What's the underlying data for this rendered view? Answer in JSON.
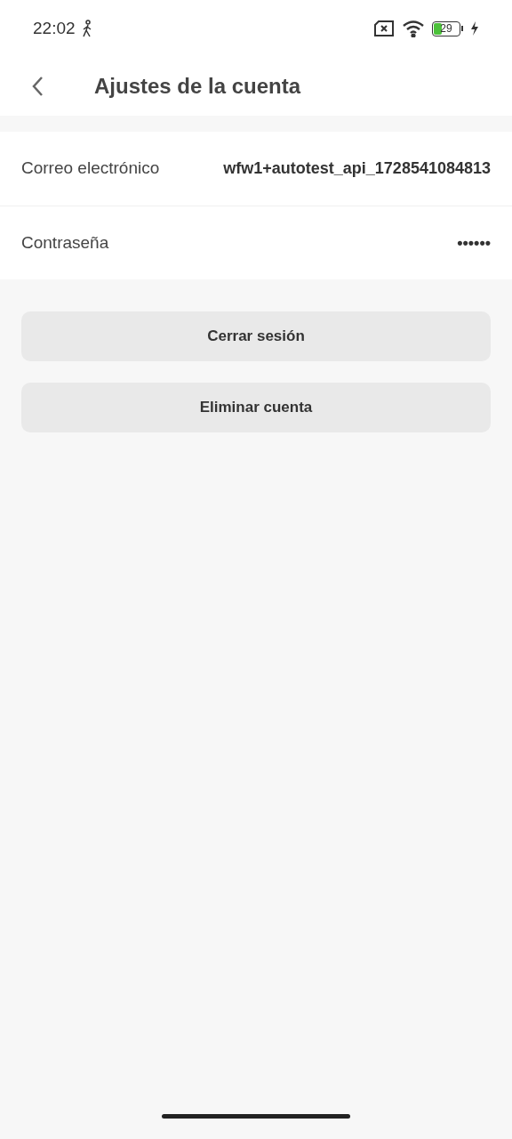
{
  "status_bar": {
    "time": "22:02",
    "battery": "29"
  },
  "header": {
    "title": "Ajustes de la cuenta"
  },
  "fields": [
    {
      "label": "Correo electrónico",
      "value": "wfw1+autotest_api_1728541084813"
    },
    {
      "label": "Contraseña",
      "value": "••••••"
    }
  ],
  "buttons": [
    "Cerrar sesión",
    "Eliminar cuenta"
  ]
}
